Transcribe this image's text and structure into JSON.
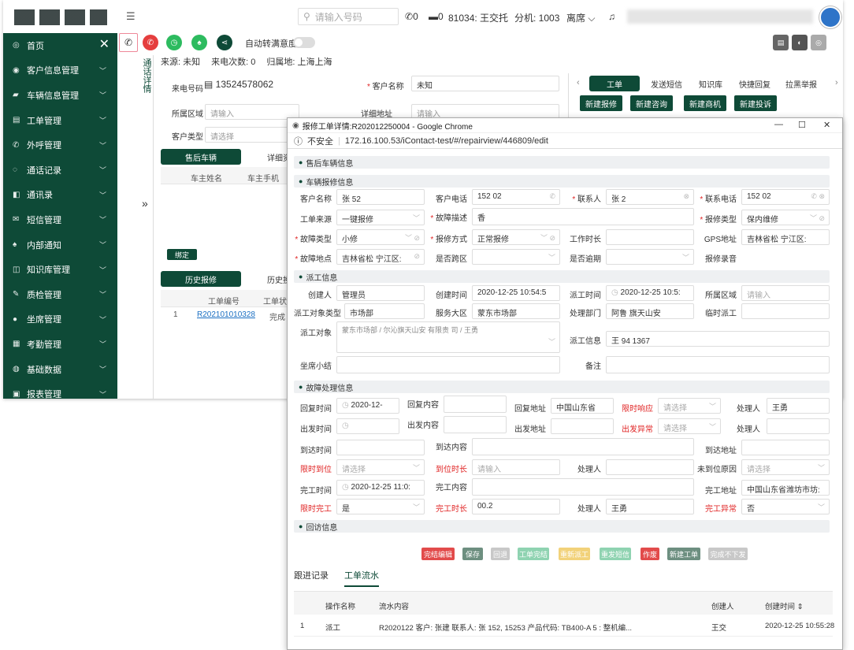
{
  "topbar": {
    "search_placeholder": "请输入号码",
    "calls": "0",
    "msgs": "0",
    "agent": "81034: 王交托",
    "ext": "分机: 1003",
    "status": "离席"
  },
  "sidebar": {
    "items": [
      "首页",
      "客户信息管理",
      "车辆信息管理",
      "工单管理",
      "外呼管理",
      "通话记录",
      "通讯录",
      "短信管理",
      "内部通知",
      "知识库管理",
      "质检管理",
      "坐席管理",
      "考勤管理",
      "基础数据",
      "报表管理"
    ]
  },
  "phonebar": {
    "auto_label": "自动转满意度"
  },
  "left": {
    "vtab": "通话详情",
    "source": "来源: 未知",
    "count": "来电次数: 0",
    "location": "归属地: 上海上海",
    "caller_label": "来电号码",
    "caller": "13524578062",
    "cust_name_label": "客户名称",
    "cust_name": "未知",
    "area_label": "所属区域",
    "area_ph": "请输入",
    "addr_label": "详细地址",
    "addr_ph": "请输入",
    "type_label": "客户类型",
    "type_ph": "请选择",
    "tab1": "售后车辆",
    "tab2": "详细资",
    "col1": "车主姓名",
    "col2": "车主手机",
    "bind": "绑定",
    "hist_tab": "历史报修",
    "hist_tab2": "历史投",
    "hcol1": "工单编号",
    "hcol2": "工单状态",
    "hrow_idx": "1",
    "hrow_id": "R202101010328",
    "hrow_status": "完成"
  },
  "right_panel": {
    "tabs": [
      "工单",
      "发送短信",
      "知识库",
      "快捷回复",
      "拉黑举报"
    ],
    "buttons": [
      "新建报修",
      "新建咨询",
      "新建商机",
      "新建投诉"
    ]
  },
  "popup": {
    "title": "报修工单详情:R202012250004 - Google Chrome",
    "insecure": "不安全",
    "url": "172.16.100.53/iContact-test/#/repairview/446809/edit",
    "sec1": "售后车辆信息",
    "sec2": "车辆报修信息",
    "sec3": "派工信息",
    "sec4": "故障处理信息",
    "sec5": "回访信息",
    "f": {
      "cust_name_l": "客户名称",
      "cust_name": "张    52",
      "cust_phone_l": "客户电话",
      "cust_phone": "152       02",
      "contact_l": "联系人",
      "contact": "张       2",
      "contact_phone_l": "联系电话",
      "contact_phone": "152       02",
      "src_l": "工单来源",
      "src": "一键报修",
      "fault_desc_l": "故障描述",
      "fault_desc": "香",
      "repair_type_l": "报修类型",
      "repair_type": "保内维修",
      "fault_type_l": "故障类型",
      "fault_type": "小修",
      "repair_way_l": "报修方式",
      "repair_way": "正常报修",
      "work_hours_l": "工作时长",
      "gps_l": "GPS地址",
      "gps": "吉林省松      宁江区:",
      "fault_loc_l": "故障地点",
      "fault_loc": "吉林省松      宁江区:",
      "is_cross_l": "是否跨区",
      "is_overdue_l": "是否逾期",
      "rec_l": "报修录音",
      "creator_l": "创建人",
      "creator": "管理员",
      "ctime_l": "创建时间",
      "ctime": "2020-12-25 10:54:5",
      "dtime_l": "派工时间",
      "dtime": "2020-12-25 10:5:",
      "region_l": "所属区域",
      "region_ph": "请输入",
      "dtype_l": "派工对象类型",
      "dtype": "市场部",
      "svc_l": "服务大区",
      "svc": "蒙东市场部",
      "dept_l": "处理部门",
      "dept": "阿鲁        旗天山安",
      "temp_l": "临时派工",
      "target_l": "派工对象",
      "target": "蒙东市场部 /        尔沁旗天山安         有限责     司 / 王勇",
      "dinfo_l": "派工信息",
      "dinfo": "王         94   1367",
      "seat_l": "坐席小结",
      "note_l": "备注",
      "reply_time_l": "回复时间",
      "reply_time": "2020-12-",
      "reply_content_l": "回复内容",
      "reply_addr_l": "回复地址",
      "reply_addr": "中国山东省",
      "limit_resp_l": "限时响应",
      "limit_resp_ph": "请选择",
      "handler_l": "处理人",
      "handler": "王勇",
      "depart_time_l": "出发时间",
      "depart_content_l": "出发内容",
      "depart_addr_l": "出发地址",
      "depart_abn_l": "出发异常",
      "depart_abn_ph": "请选择",
      "handler2_l": "处理人",
      "arrive_time_l": "到达时间",
      "arrive_content_l": "到达内容",
      "arrive_addr_l": "到达地址",
      "limit_arrive_l": "限时到位",
      "limit_arrive_ph": "请选择",
      "arrive_dur_l": "到位时长",
      "arrive_dur_ph": "请输入",
      "handler3_l": "处理人",
      "no_arrive_l": "未到位原因",
      "no_arrive_ph": "请选择",
      "finish_time_l": "完工时间",
      "finish_time": "2020-12-25 11:0:",
      "finish_content_l": "完工内容",
      "finish_addr_l": "完工地址",
      "finish_addr": "中国山东省潍坊市坊:",
      "limit_finish_l": "限时完工",
      "limit_finish": "是",
      "finish_dur_l": "完工时长",
      "finish_dur": "00.2",
      "handler4_l": "处理人",
      "handler4": "王勇",
      "finish_abn_l": "完工异常",
      "finish_abn": "否"
    },
    "actions": [
      "完结编辑",
      "保存",
      "回退",
      "工单完结",
      "重新派工",
      "重发短信",
      "作废",
      "新建工单",
      "完成不下发"
    ],
    "tabs": [
      "跟进记录",
      "工单流水"
    ],
    "table": {
      "cols": [
        "操作名称",
        "流水内容",
        "创建人",
        "创建时间"
      ],
      "row": {
        "idx": "1",
        "op": "派工",
        "content": "R2020122       客户: 张建     联系人: 张     152, 15253       产品代码: TB400-A    5    : 整机编...",
        "creator": "王交",
        "time": "2020-12-25 10:55:28"
      }
    }
  }
}
